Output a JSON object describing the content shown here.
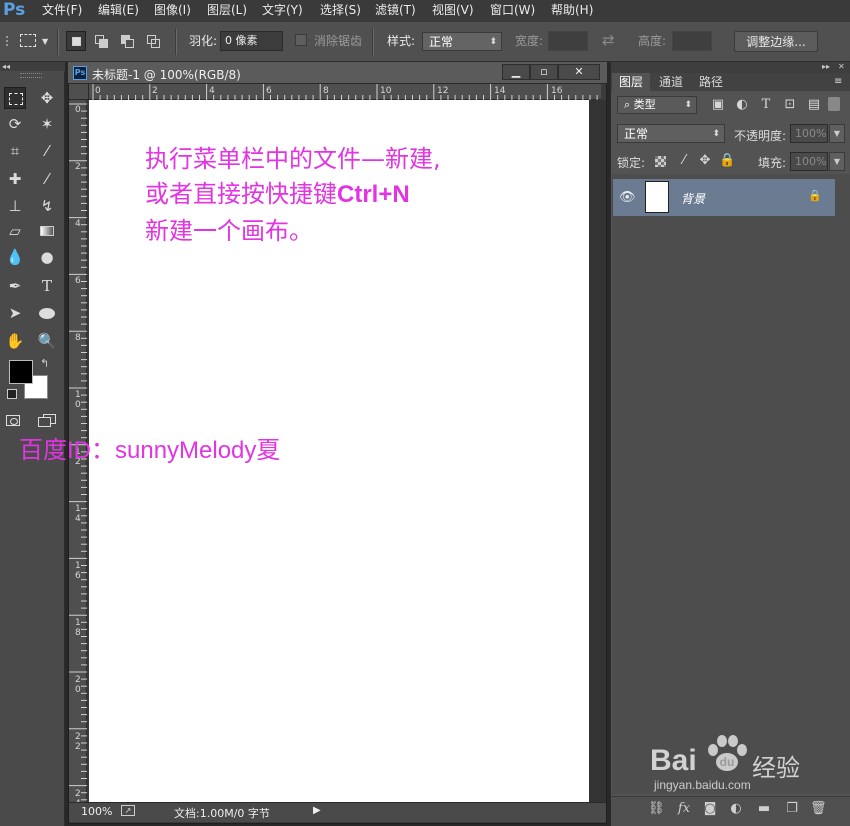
{
  "app": {
    "logo": "Ps",
    "brand_color": "#5aa0e0"
  },
  "menu": [
    "文件(F)",
    "编辑(E)",
    "图像(I)",
    "图层(L)",
    "文字(Y)",
    "选择(S)",
    "滤镜(T)",
    "视图(V)",
    "窗口(W)",
    "帮助(H)"
  ],
  "options": {
    "feather_label": "羽化:",
    "feather_value": "0 像素",
    "antialias_label": "消除锯齿",
    "style_label": "样式:",
    "style_value": "正常",
    "width_label": "宽度:",
    "height_label": "高度:",
    "refine_button": "调整边缘..."
  },
  "document": {
    "title": "未标题-1 @ 100%(RGB/8)",
    "ruler_h": [
      "0",
      "2",
      "4",
      "6",
      "8",
      "10",
      "12",
      "14",
      "16"
    ],
    "ruler_v": [
      "0",
      "2",
      "4",
      "6",
      "8",
      "1\n0",
      "1\n2",
      "1\n4",
      "1\n6",
      "1\n8",
      "2\n0",
      "2\n2",
      "2\n4"
    ],
    "zoom": "100%",
    "doc_info": "文档:1.00M/0 字节",
    "bg_color": "#ffffff"
  },
  "annotation": {
    "line1": "执行菜单栏中的文件—新建,",
    "line2_prefix": "或者直接按快捷键",
    "line2_shortcut": "Ctrl+N",
    "line3": "新建一个画布。",
    "signature": "百度ID：sunnyMelody夏",
    "color": "#e234e2"
  },
  "panel": {
    "tabs": [
      "图层",
      "通道",
      "路径"
    ],
    "active_tab": "图层",
    "kind_filter": "类型",
    "blend_mode": "正常",
    "opacity_label": "不透明度:",
    "opacity_value": "100%",
    "lock_label": "锁定:",
    "fill_label": "填充:",
    "fill_value": "100%",
    "layers": [
      {
        "name": "背景",
        "visible": true,
        "locked": true
      }
    ],
    "selected_color": "#6b7b92"
  },
  "watermark": {
    "brand": "Bai",
    "brand_suffix": "经验",
    "url": "jingyan.baidu.com"
  }
}
